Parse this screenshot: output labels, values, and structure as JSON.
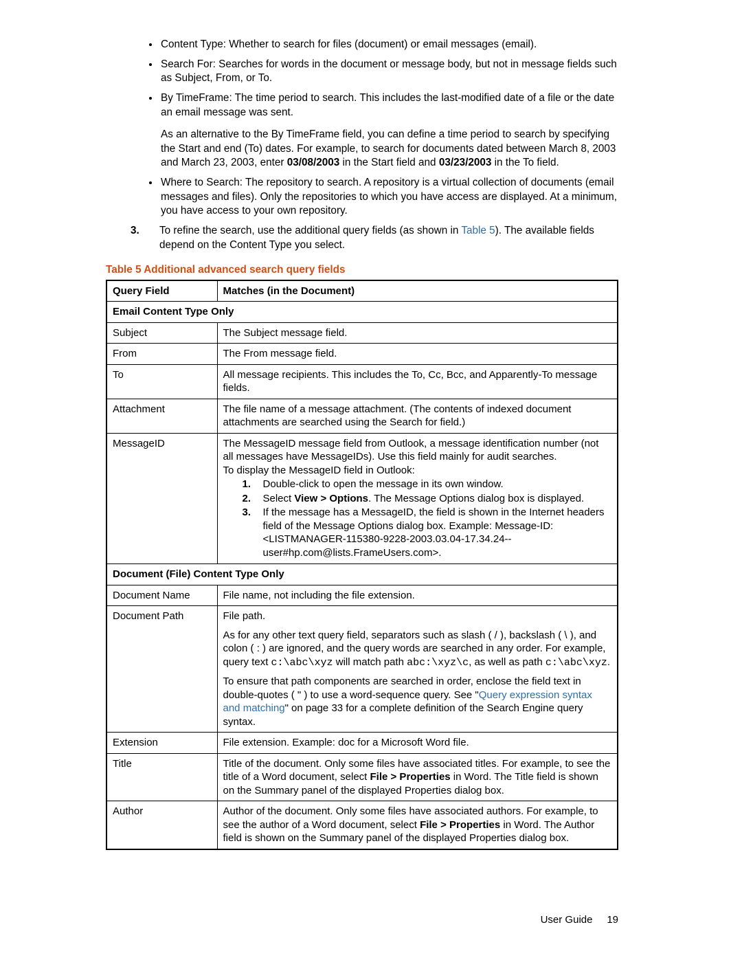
{
  "bullets": {
    "b1": "Content Type: Whether to search for files (document) or email messages (email).",
    "b2": "Search For: Searches for words in the document or message body, but not in message fields such as Subject, From, or To.",
    "b3": "By TimeFrame: The time period to search. This includes the last-modified date of a file or the date an email message was sent.",
    "b3_para_a": "As an alternative to the By TimeFrame field, you can define a time period to search by specifying the Start and end (To) dates. For example, to search for documents dated between March 8, 2003 and March 23, 2003, enter ",
    "b3_bold1": "03/08/2003",
    "b3_mid": " in the Start field and ",
    "b3_bold2": "03/23/2003",
    "b3_end": " in the To field.",
    "b4": "Where to Search: The repository to search. A repository is a virtual collection of documents (email messages and files). Only the repositories to which you have access are displayed. At a minimum, you have access to your own repository."
  },
  "step3": {
    "num": "3.",
    "pre": "To refine the search, use the additional query fields (as shown in ",
    "link": "Table 5",
    "post": "). The available fields depend on the Content Type you select."
  },
  "table_title": "Table 5 Additional advanced search query fields",
  "headers": {
    "c1": "Query Field",
    "c2": "Matches (in the Document)"
  },
  "section1": "Email Content Type Only",
  "rows_email": {
    "subject": {
      "q": "Subject",
      "m": "The Subject message field."
    },
    "from": {
      "q": "From",
      "m": "The From message field."
    },
    "to": {
      "q": "To",
      "m": "All message recipients. This includes the To, Cc, Bcc, and Apparently-To message fields."
    },
    "attach": {
      "q": "Attachment",
      "m": "The file name of a message attachment. (The contents of indexed document attachments are searched using the Search for field.)"
    },
    "msgid": {
      "q": "MessageID",
      "p1": "The MessageID message field from Outlook, a message identification number (not all messages have MessageIDs). Use this field mainly for audit searches.",
      "p2": "To display the MessageID field in Outlook:",
      "s1n": "1.",
      "s1": "Double-click to open the message in its own window.",
      "s2n": "2.",
      "s2a": "Select ",
      "s2b": "View > Options",
      "s2c": ". The Message Options dialog box is displayed.",
      "s3n": "3.",
      "s3": "If the message has a MessageID, the field is shown in the Internet headers field of the Message Options dialog box. Example: Message-ID: <LISTMANAGER-115380-9228-2003.03.04-17.34.24--user#hp.com@lists.FrameUsers.com>."
    }
  },
  "section2": "Document (File) Content Type Only",
  "rows_doc": {
    "name": {
      "q": "Document Name",
      "m": "File name, not including the file extension."
    },
    "path": {
      "q": "Document Path",
      "p1": "File path.",
      "p2a": "As for any other text query field, separators such as slash ( / ), backslash ( \\ ), and colon ( : ) are ignored, and the query words are searched in any order. For example, query text ",
      "p2c1": "c:\\abc\\xyz",
      "p2b": " will match path ",
      "p2c2": "abc:\\xyz\\c",
      "p2c": ", as well as path ",
      "p2c3": "c:\\abc\\xyz",
      "p2d": ".",
      "p3a": "To ensure that path components are searched in order, enclose the field text in double-quotes ( \" ) to use a word-sequence query. See \"",
      "p3link": "Query expression syntax and matching",
      "p3b": "\" on page 33 for a complete definition of the Search Engine query syntax."
    },
    "ext": {
      "q": "Extension",
      "m": "File extension. Example: doc for a Microsoft Word file."
    },
    "title": {
      "q": "Title",
      "a": "Title of the document. Only some files have associated titles. For example, to see the title of a Word document, select ",
      "b": "File > Properties",
      "c": " in Word. The Title field is shown on the Summary panel of the displayed Properties dialog box."
    },
    "author": {
      "q": "Author",
      "a": "Author of the document. Only some files have associated authors. For example, to see the author of a Word document, select ",
      "b": "File > Properties",
      "c": " in Word. The Author field is shown on the Summary panel of the displayed Properties dialog box."
    }
  },
  "footer": {
    "label": "User Guide",
    "page": "19"
  }
}
